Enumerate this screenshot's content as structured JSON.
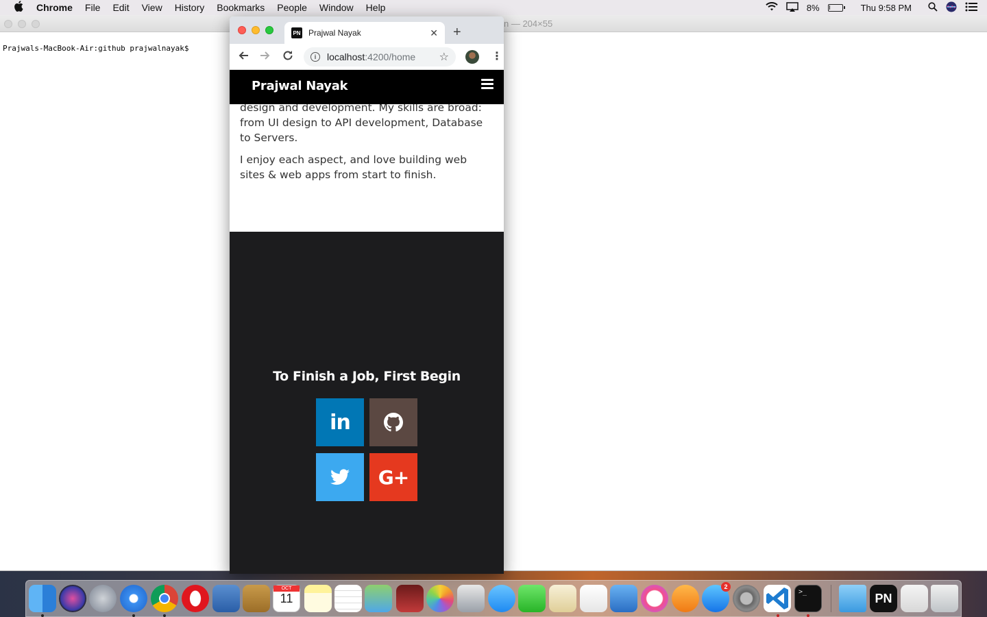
{
  "menubar": {
    "app": "Chrome",
    "items": [
      "File",
      "Edit",
      "View",
      "History",
      "Bookmarks",
      "People",
      "Window",
      "Help"
    ],
    "battery_percent": "8%",
    "battery_level": 0.08,
    "clock": "Thu 9:58 PM"
  },
  "terminal": {
    "title": "n — 204×55",
    "prompt": "Prajwals-MacBook-Air:github prajwalnayak$"
  },
  "browser": {
    "tab_title": "Prajwal Nayak",
    "favicon_text": "PN",
    "url_host": "localhost",
    "url_path": ":4200/home"
  },
  "site": {
    "brand": "Prajwal Nayak",
    "about_paragraphs": [
      "design and development. My skills are broad: from UI design to API development, Database to Servers.",
      "I enjoy each aspect, and love building web sites & web apps from start to finish."
    ],
    "footer_tagline": "To Finish a Job, First Begin",
    "social": {
      "linkedin": "in",
      "gplus": "G+"
    }
  },
  "dock": {
    "calendar_month": "OCT",
    "calendar_day": "11",
    "appstore_badge": "2",
    "pn_label": "PN"
  }
}
